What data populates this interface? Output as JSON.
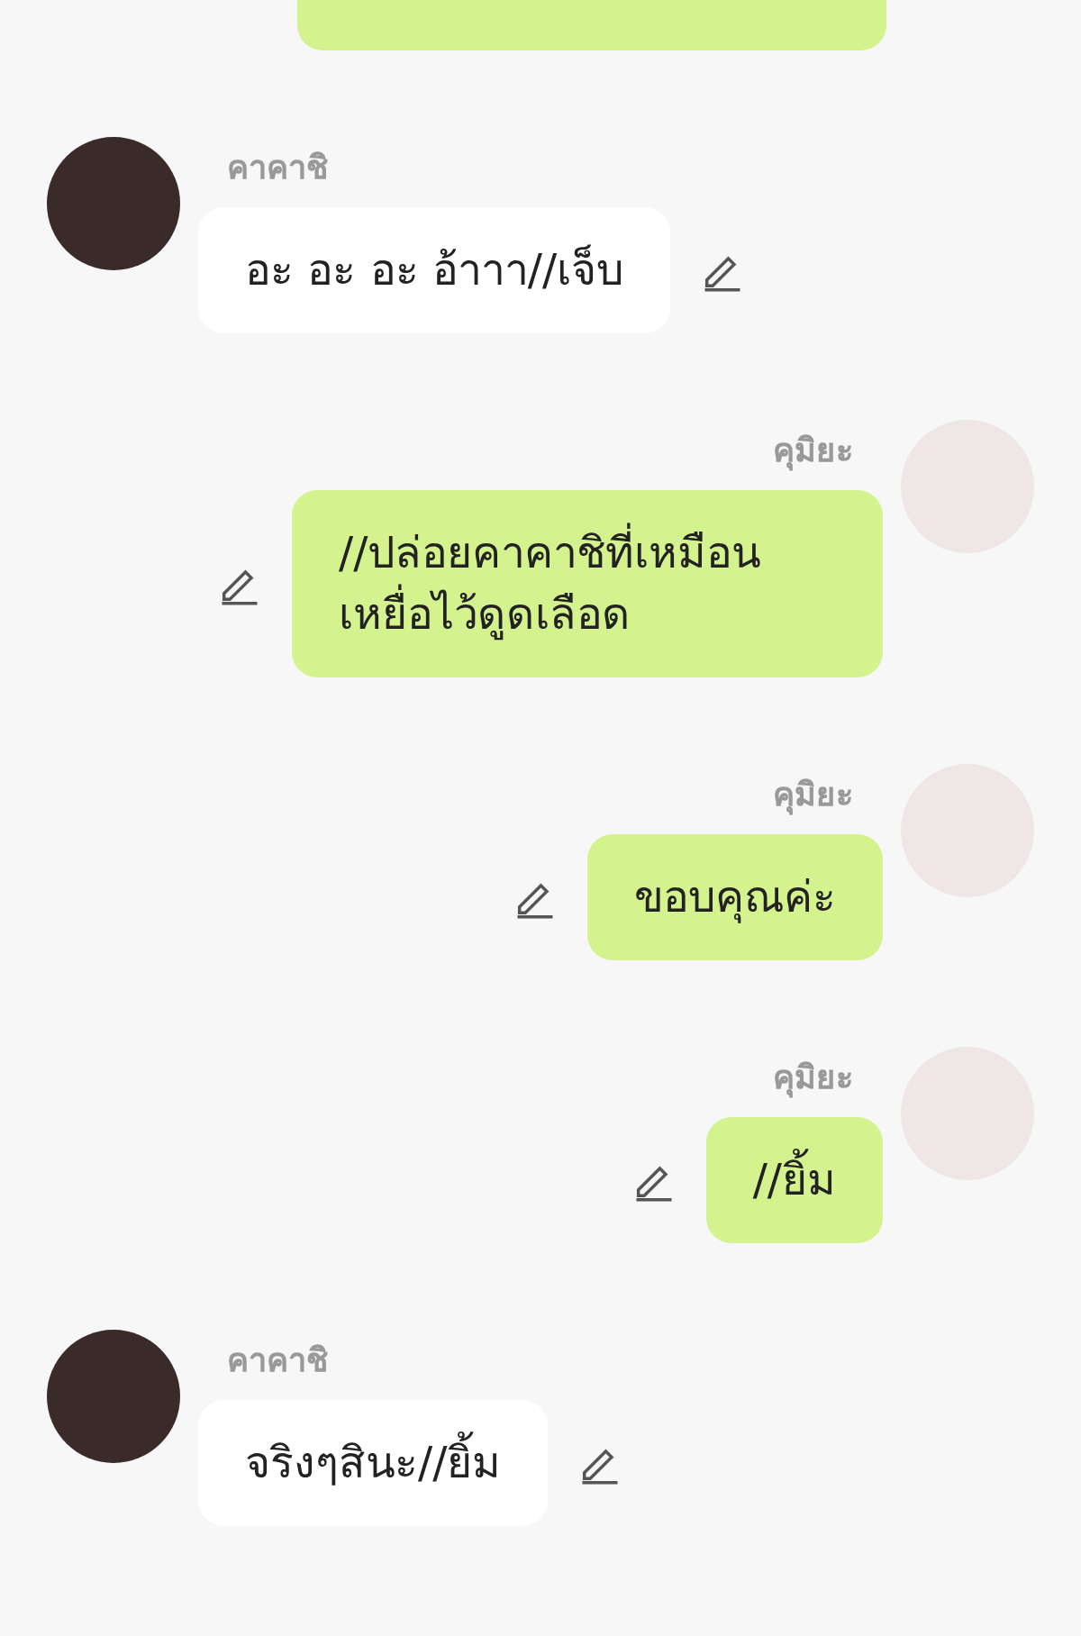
{
  "messages": [
    {
      "kind": "cut"
    },
    {
      "kind": "incoming",
      "name": "คาคาชิ",
      "text": "อะ อะ อะ อ้าาา//เจ็บ"
    },
    {
      "kind": "outgoing",
      "name": "คุมิยะ",
      "text": "//ปล่อยคาคาชิที่เหมือนเหยื่อไว้ดูดเลือด"
    },
    {
      "kind": "outgoing",
      "name": "คุมิยะ",
      "text": "ขอบคุณค่ะ"
    },
    {
      "kind": "outgoing",
      "name": "คุมิยะ",
      "text": "//ยิ้ม"
    },
    {
      "kind": "incoming",
      "name": "คาคาชิ",
      "text": "จริงๆสินะ//ยิ้ม"
    }
  ]
}
